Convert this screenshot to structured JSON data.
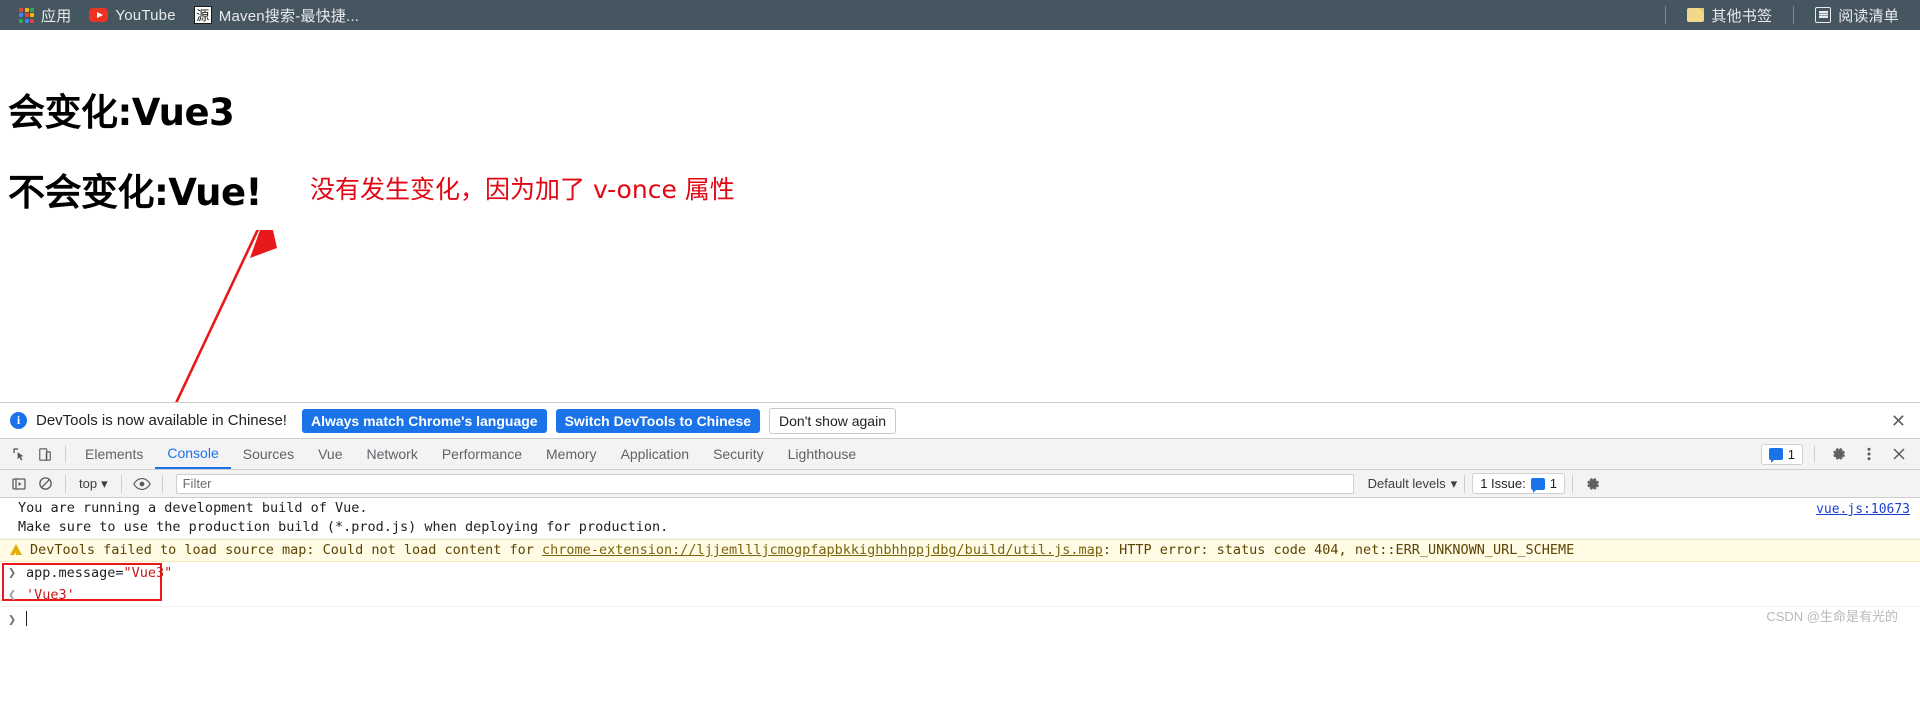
{
  "bookmarks_bar": {
    "items": [
      {
        "icon": "apps-grid-icon",
        "label": "应用"
      },
      {
        "icon": "youtube-icon",
        "label": "YouTube"
      },
      {
        "icon": "maven-icon",
        "icon_text": "源",
        "label": "Maven搜索-最快捷..."
      }
    ],
    "right_items": [
      {
        "icon": "folder-icon",
        "label": "其他书签"
      },
      {
        "icon": "reading-list-icon",
        "label": "阅读清单"
      }
    ]
  },
  "page": {
    "heading_changing": "会变化:Vue3",
    "heading_static": "不会变化:Vue!",
    "annotation": "没有发生变化，因为加了 v-once 属性",
    "annotation_color": "#e30613",
    "arrow_color": "#e8191b"
  },
  "devtools_notice": {
    "info_icon": "info-icon",
    "message": "DevTools is now available in Chinese!",
    "buttons": [
      {
        "label": "Always match Chrome's language",
        "style": "primary"
      },
      {
        "label": "Switch DevTools to Chinese",
        "style": "primary"
      },
      {
        "label": "Don't show again",
        "style": "plain"
      }
    ],
    "close_label": "✕"
  },
  "devtools": {
    "left_icons": [
      "inspect-element-icon",
      "device-toolbar-icon"
    ],
    "tabs": [
      {
        "label": "Elements",
        "active": false
      },
      {
        "label": "Console",
        "active": true
      },
      {
        "label": "Sources",
        "active": false
      },
      {
        "label": "Vue",
        "active": false
      },
      {
        "label": "Network",
        "active": false
      },
      {
        "label": "Performance",
        "active": false
      },
      {
        "label": "Memory",
        "active": false
      },
      {
        "label": "Application",
        "active": false
      },
      {
        "label": "Security",
        "active": false
      },
      {
        "label": "Lighthouse",
        "active": false
      }
    ],
    "tabbar_right": {
      "message_count": "1",
      "settings_icon": "gear-icon",
      "more_icon": "more-vertical-icon",
      "close_icon": "close-icon"
    },
    "filterbar": {
      "execute_icon": "execute-script-icon",
      "clear_icon": "clear-console-icon",
      "context": "top",
      "eye_icon": "live-expression-icon",
      "filter_placeholder": "Filter",
      "filter_value": "",
      "levels": "Default levels",
      "issues_label": "1 Issue:",
      "issues_count": "1",
      "settings_icon": "gear-icon"
    },
    "console": {
      "info_lines": [
        "You are running a development build of Vue.",
        "Make sure to use the production build (*.prod.js) when deploying for production."
      ],
      "info_source": "vue.js:10673",
      "warning": {
        "prefix": "DevTools failed to load source map: Could not load content for ",
        "link": "chrome-extension://ljjemllljcmogpfapbkkighbhhppjdbg/build/util.js.map",
        "suffix": ": HTTP error: status code 404, net::ERR_UNKNOWN_URL_SCHEME"
      },
      "evaluation": {
        "input_prompt": "❯",
        "input_expr_left": "app.message=",
        "input_expr_string": "\"Vue3\"",
        "output_prompt": "❮",
        "output_value": "'Vue3'"
      },
      "prompt_symbol": "❯"
    }
  },
  "watermark": "CSDN @生命是有光的"
}
